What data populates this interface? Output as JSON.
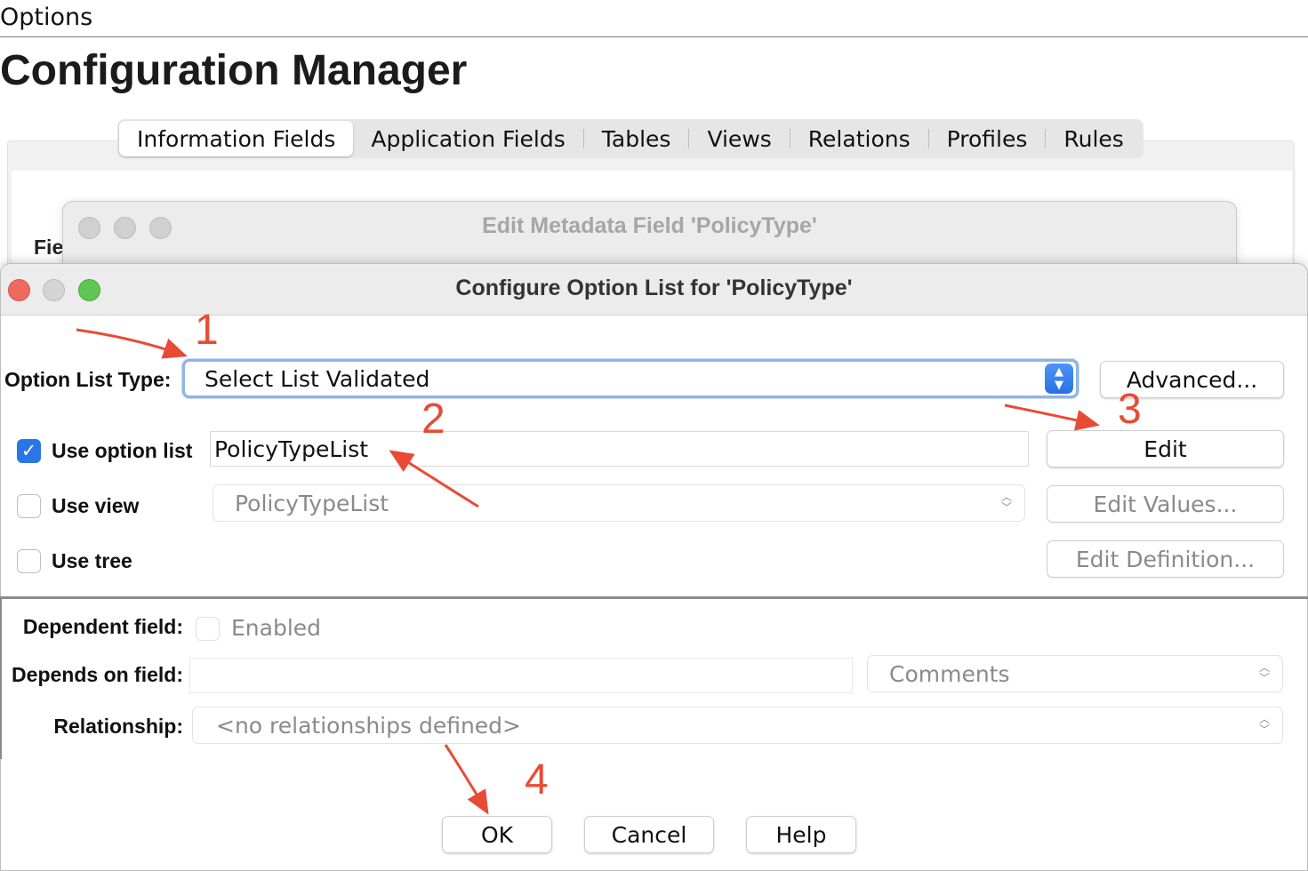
{
  "window": {
    "options_label": "Options",
    "app_title": "Configuration Manager",
    "fields_label_partial": "Fie"
  },
  "tabs": [
    {
      "label": "Information Fields",
      "active": true
    },
    {
      "label": "Application Fields",
      "active": false
    },
    {
      "label": "Tables",
      "active": false
    },
    {
      "label": "Views",
      "active": false
    },
    {
      "label": "Relations",
      "active": false
    },
    {
      "label": "Profiles",
      "active": false
    },
    {
      "label": "Rules",
      "active": false
    }
  ],
  "metadata_window": {
    "title": "Edit Metadata Field 'PolicyType'"
  },
  "dialog": {
    "title": "Configure Option List for 'PolicyType'",
    "option_list_type": {
      "label": "Option List Type:",
      "value": "Select List Validated"
    },
    "advanced_button": "Advanced...",
    "use_option_list": {
      "label": "Use option list",
      "checked": true,
      "value": "PolicyTypeList"
    },
    "edit_button": "Edit",
    "use_view": {
      "label": "Use view",
      "checked": false,
      "value": "PolicyTypeList"
    },
    "edit_values_button": "Edit Values...",
    "use_tree": {
      "label": "Use tree",
      "checked": false
    },
    "edit_definition_button": "Edit Definition...",
    "dependent_field": {
      "label": "Dependent field:",
      "checkbox_label": "Enabled",
      "checked": false
    },
    "depends_on_field": {
      "label": "Depends on field:",
      "value": "",
      "select_value": "Comments"
    },
    "relationship": {
      "label": "Relationship:",
      "value": "<no relationships defined>"
    },
    "buttons": {
      "ok": "OK",
      "cancel": "Cancel",
      "help": "Help"
    }
  },
  "annotations": {
    "step1": "1",
    "step2": "2",
    "step3": "3",
    "step4": "4",
    "color": "#e84b35"
  },
  "colors": {
    "accent": "#2a76e8",
    "traffic_red": "#ed6a5e",
    "traffic_green": "#61c554"
  }
}
